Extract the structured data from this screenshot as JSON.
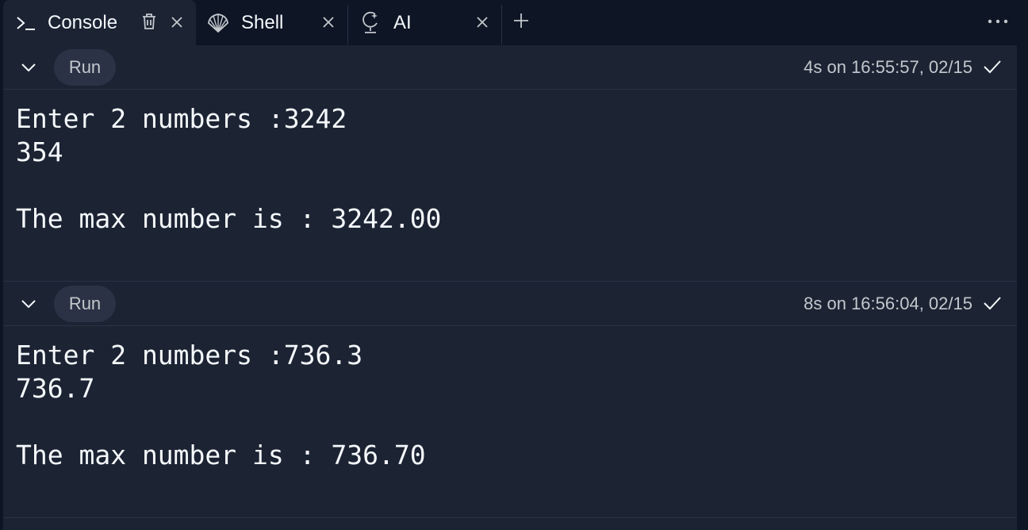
{
  "tabs": [
    {
      "label": "Console",
      "icon": "terminal-prompt-icon",
      "active": true
    },
    {
      "label": "Shell",
      "icon": "shell-icon",
      "active": false
    },
    {
      "label": "AI",
      "icon": "ai-icon",
      "active": false
    }
  ],
  "runs": [
    {
      "button_label": "Run",
      "meta": "4s on 16:55:57, 02/15",
      "status": "success",
      "output_lines": [
        "Enter 2 numbers :3242",
        "354",
        "",
        "The max number is : 3242.00"
      ]
    },
    {
      "button_label": "Run",
      "meta": "8s on 16:56:04, 02/15",
      "status": "success",
      "output_lines": [
        "Enter 2 numbers :736.3",
        "736.7",
        "",
        "The max number is : 736.70"
      ]
    }
  ],
  "colors": {
    "background": "#0e1525",
    "pane": "#1c2333",
    "pill": "#2b3245",
    "text": "#f5f9fc",
    "muted": "#c2c8cc"
  }
}
